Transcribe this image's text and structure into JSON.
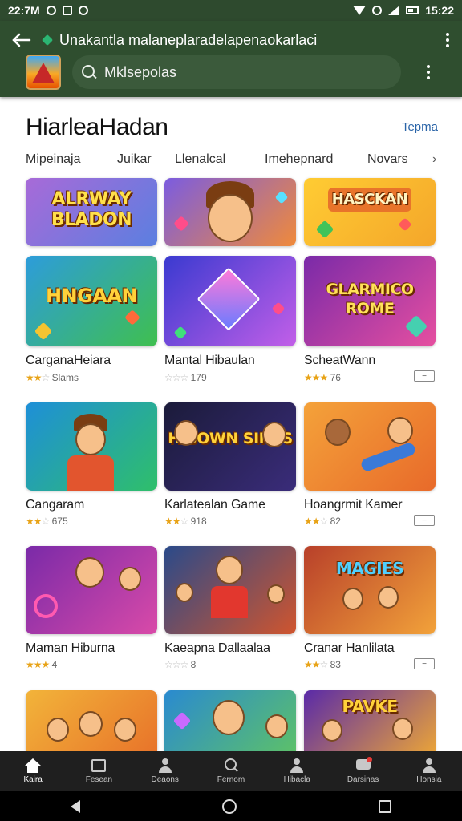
{
  "status_bar": {
    "time": "22:7M",
    "right_time": "15:22"
  },
  "header": {
    "title": "Unakantla malaneplaradelapenaokarlaci",
    "search_placeholder": "Mklsepolas"
  },
  "section": {
    "title": "HiarleaHadan",
    "see_more": "Tepma"
  },
  "categories": [
    "Mipeinaja",
    "Juikar",
    "Llenalcal",
    "Imehepnard",
    "Novars"
  ],
  "featured_tiles": [
    {
      "text": "ALRWAY BLADON",
      "colors": [
        "#a86ad8",
        "#5b7fe0"
      ]
    },
    {
      "text": "",
      "colors": [
        "#7b5ce0",
        "#f08a3a"
      ]
    },
    {
      "text": "HASCKAN",
      "colors": [
        "#ffcc33",
        "#f4a62a"
      ]
    }
  ],
  "games": [
    {
      "title": "CarganaHeiara",
      "rating": "Slams",
      "stars": 2,
      "tile_text": "HNGAAN",
      "colors": [
        "#2d9cdb",
        "#3fbf4f"
      ]
    },
    {
      "title": "Mantal Hibaulan",
      "rating": "179",
      "stars": 0,
      "tile_text": "",
      "colors": [
        "#3a3ad0",
        "#c25fe8"
      ]
    },
    {
      "title": "ScheatWann",
      "rating": "76",
      "stars": 3,
      "tile_text": "GLARMICO ROME",
      "colors": [
        "#7a2aa8",
        "#e64fa0"
      ]
    },
    {
      "title": "Cangaram",
      "rating": "675",
      "stars": 2,
      "tile_text": "",
      "colors": [
        "#1e8fd8",
        "#2fbf6a"
      ]
    },
    {
      "title": "Karlatealan Game",
      "rating": "918",
      "stars": 2,
      "tile_text": "HIBOWN SINPS",
      "colors": [
        "#1b1b3a",
        "#3a2c7a"
      ]
    },
    {
      "title": "Hoangrmit Kamer",
      "rating": "82",
      "stars": 2,
      "tile_text": "",
      "colors": [
        "#f4a23a",
        "#e86a2a"
      ]
    },
    {
      "title": "Maman Hiburna",
      "rating": "4",
      "stars": 3,
      "tile_text": "",
      "colors": [
        "#7a2aa8",
        "#d94aa8"
      ]
    },
    {
      "title": "Kaeapna Dallaalaa",
      "rating": "8",
      "stars": 0,
      "tile_text": "",
      "colors": [
        "#2a4a8a",
        "#d0552e"
      ]
    },
    {
      "title": "Cranar Hanlilata",
      "rating": "83",
      "stars": 2,
      "tile_text": "MAGIES",
      "colors": [
        "#b8402a",
        "#f2a23a"
      ]
    }
  ],
  "bottom_row": [
    {
      "colors": [
        "#f2b43a",
        "#e8742a"
      ]
    },
    {
      "colors": [
        "#2a8ad0",
        "#5cc06a"
      ]
    },
    {
      "colors": [
        "#5a2aa8",
        "#e8a23a"
      ],
      "tile_text": "PAVKE"
    }
  ],
  "bottom_nav": [
    {
      "label": "Kaira",
      "icon": "home-icon"
    },
    {
      "label": "Fesean",
      "icon": "box-icon"
    },
    {
      "label": "Deaons",
      "icon": "person-icon"
    },
    {
      "label": "Fernom",
      "icon": "search-icon"
    },
    {
      "label": "Hibacla",
      "icon": "person-icon"
    },
    {
      "label": "Darsinas",
      "icon": "chat-icon"
    },
    {
      "label": "Honsia",
      "icon": "person-icon"
    }
  ]
}
